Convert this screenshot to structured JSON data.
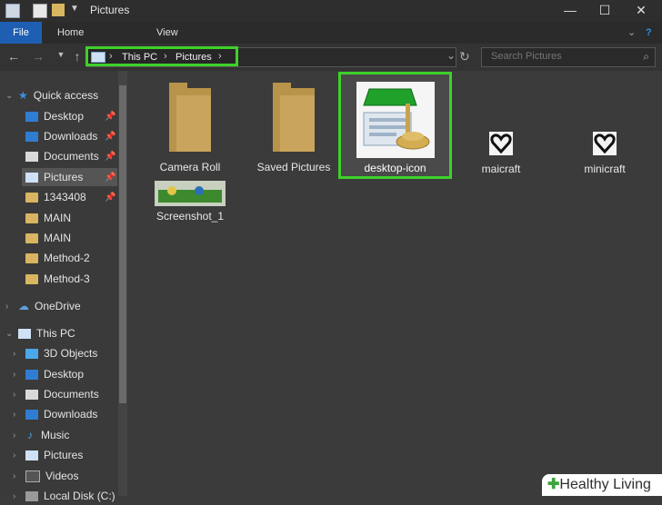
{
  "window": {
    "title": "Pictures",
    "min": "—",
    "max": "☐",
    "close": "✕"
  },
  "ribbon": {
    "tabs": [
      "File",
      "Home",
      "View"
    ],
    "help": "?"
  },
  "address": {
    "crumbs": [
      "This PC",
      "Pictures"
    ],
    "refresh": "↻",
    "dropdown": "⌄"
  },
  "search": {
    "placeholder": "Search Pictures"
  },
  "nav": {
    "quick_access": "Quick access",
    "quick_items": [
      {
        "label": "Desktop",
        "icon": "desktop-icon"
      },
      {
        "label": "Downloads",
        "icon": "download-icon"
      },
      {
        "label": "Documents",
        "icon": "documents-icon"
      },
      {
        "label": "Pictures",
        "icon": "pictures-icon"
      },
      {
        "label": "1343408",
        "icon": "folder-icon"
      },
      {
        "label": "MAIN",
        "icon": "folder-icon"
      },
      {
        "label": "MAIN",
        "icon": "folder-icon"
      },
      {
        "label": "Method-2",
        "icon": "folder-icon"
      },
      {
        "label": "Method-3",
        "icon": "folder-icon"
      }
    ],
    "onedrive": "OneDrive",
    "this_pc": "This PC",
    "pc_items": [
      {
        "label": "3D Objects",
        "icon": "3d-objects-icon"
      },
      {
        "label": "Desktop",
        "icon": "desktop-icon"
      },
      {
        "label": "Documents",
        "icon": "documents-icon"
      },
      {
        "label": "Downloads",
        "icon": "download-icon"
      },
      {
        "label": "Music",
        "icon": "music-icon"
      },
      {
        "label": "Pictures",
        "icon": "pictures-icon"
      },
      {
        "label": "Videos",
        "icon": "videos-icon"
      },
      {
        "label": "Local Disk (C:)",
        "icon": "disk-icon"
      }
    ]
  },
  "files": [
    {
      "label": "Camera Roll",
      "type": "folder"
    },
    {
      "label": "Saved Pictures",
      "type": "folder"
    },
    {
      "label": "desktop-icon",
      "type": "image",
      "selected": true
    },
    {
      "label": "maicraft",
      "type": "image"
    },
    {
      "label": "minicraft",
      "type": "image"
    },
    {
      "label": "Screenshot_1",
      "type": "image"
    }
  ],
  "watermark": {
    "plus": "✚",
    "text": "Healthy Living"
  }
}
